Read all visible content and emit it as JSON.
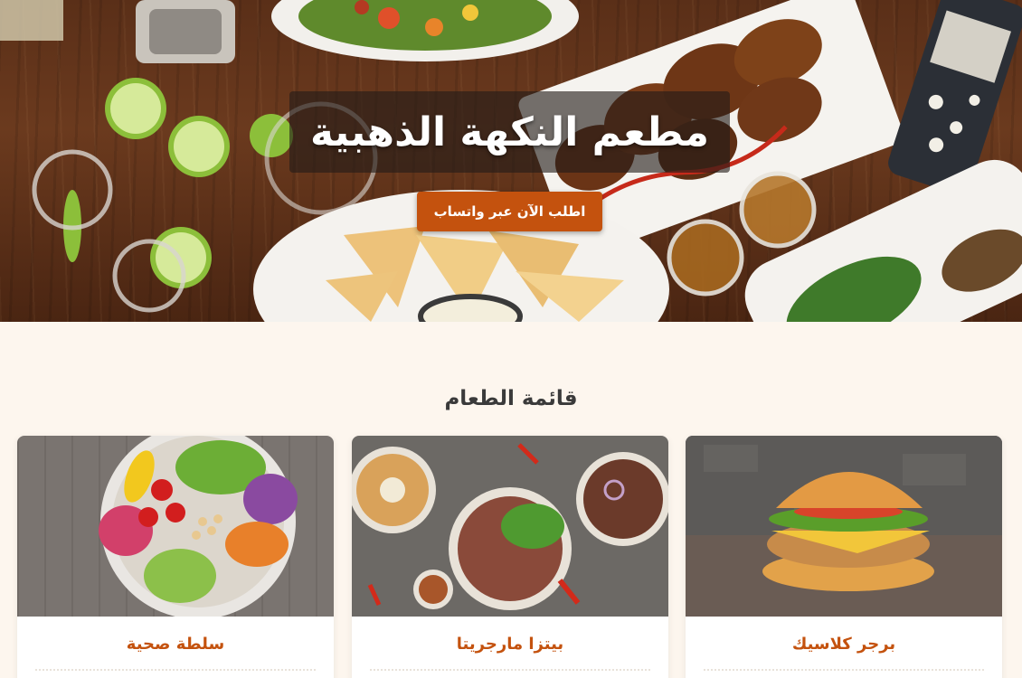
{
  "hero": {
    "title": "مطعم النكهة الذهبية",
    "cta_label": "اطلب الآن عبر واتساب"
  },
  "menu": {
    "title": "قائمة الطعام",
    "items": [
      {
        "name": "برجر كلاسيك",
        "image_icon": "burger-photo"
      },
      {
        "name": "بيتزا مارجريتا",
        "image_icon": "steak-plates-photo"
      },
      {
        "name": "سلطة صحية",
        "image_icon": "salad-bowl-photo"
      }
    ]
  },
  "colors": {
    "accent": "#c4520e",
    "page_background": "#fdf6ee",
    "title_text": "#3a3a3a"
  }
}
